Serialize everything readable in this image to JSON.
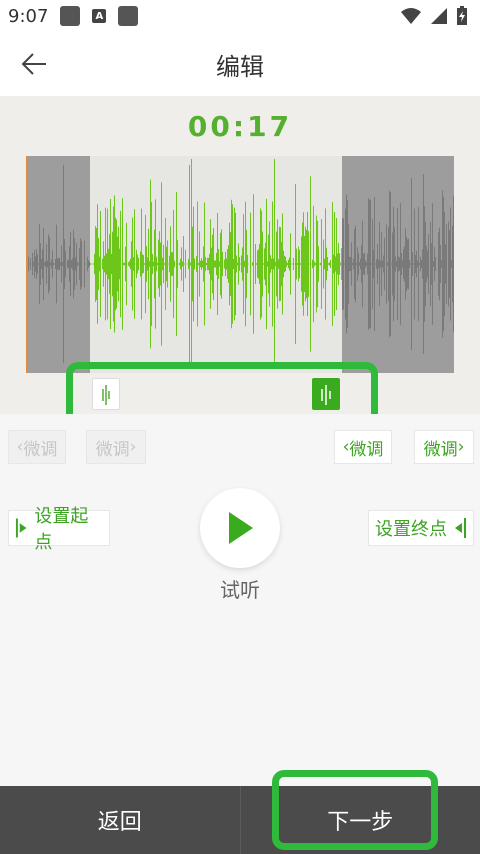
{
  "status_bar": {
    "time": "9:07",
    "icon_a_label": "A"
  },
  "app_bar": {
    "title": "编辑"
  },
  "editor": {
    "timer": "00:17"
  },
  "tweak": {
    "left_minus": "微调",
    "left_plus": "微调",
    "right_minus": "微调",
    "right_plus": "微调"
  },
  "actions": {
    "set_start": "设置起点",
    "set_end": "设置终点",
    "listen": "试听"
  },
  "bottom": {
    "back": "返回",
    "next": "下一步"
  },
  "colors": {
    "accent": "#3aab1f",
    "highlight": "#2fba3b",
    "wave_active": "#6cc71a",
    "wave_inactive": "#7a7a7a"
  }
}
